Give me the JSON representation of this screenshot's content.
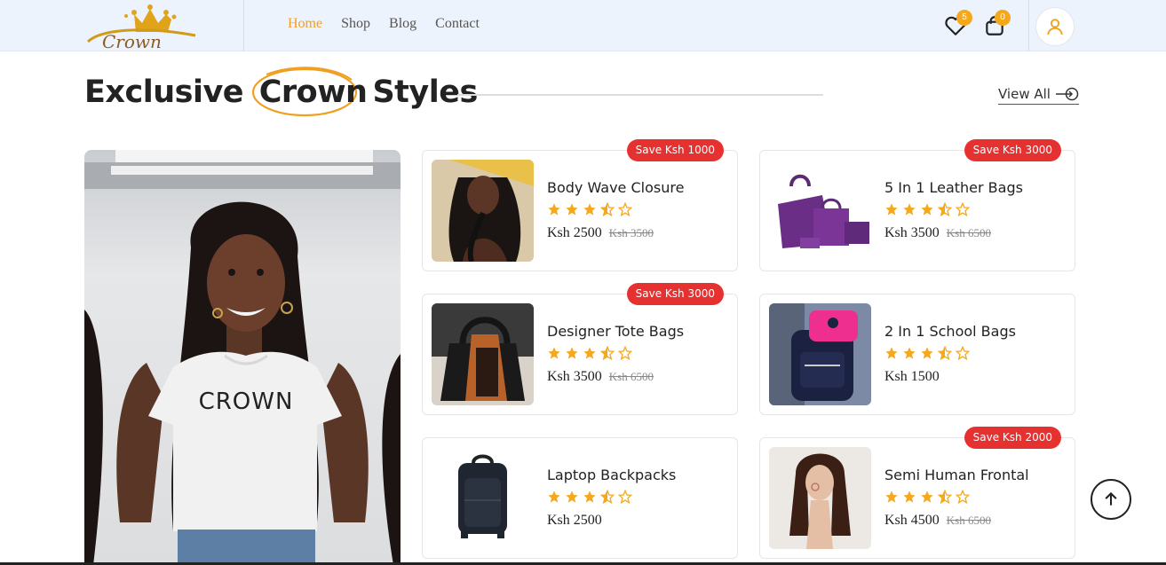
{
  "header": {
    "logo_text": "Crown",
    "nav": [
      {
        "label": "Home",
        "active": true
      },
      {
        "label": "Shop",
        "active": false
      },
      {
        "label": "Blog",
        "active": false
      },
      {
        "label": "Contact",
        "active": false
      }
    ],
    "wishlist_count": "5",
    "cart_count": "0",
    "icons": [
      "heart-icon",
      "shopping-bag-icon",
      "user-icon"
    ]
  },
  "section": {
    "title_before": "Exclusive",
    "title_accent": "Crown",
    "title_after": "Styles",
    "view_all": "View All"
  },
  "hero": {
    "shirt_text": "CROWN"
  },
  "products": [
    {
      "name": "Body Wave Closure",
      "rating": 3.5,
      "price": "Ksh 2500",
      "old_price": "Ksh 3500",
      "save": "Save Ksh 1000"
    },
    {
      "name": "5 In 1 Leather Bags",
      "rating": 3.5,
      "price": "Ksh 3500",
      "old_price": "Ksh 6500",
      "save": "Save Ksh 3000"
    },
    {
      "name": "Designer Tote Bags",
      "rating": 3.5,
      "price": "Ksh 3500",
      "old_price": "Ksh 6500",
      "save": "Save Ksh 3000"
    },
    {
      "name": "2 In 1 School Bags",
      "rating": 3.5,
      "price": "Ksh 1500",
      "old_price": "",
      "save": ""
    },
    {
      "name": "Laptop Backpacks",
      "rating": 3.5,
      "price": "Ksh 2500",
      "old_price": "",
      "save": ""
    },
    {
      "name": "Semi Human Frontal",
      "rating": 3.5,
      "price": "Ksh 4500",
      "old_price": "Ksh 6500",
      "save": "Save Ksh 2000"
    }
  ],
  "colors": {
    "accent": "#f0a020",
    "save_badge": "#e5312f",
    "header_bg": "#edf3fc",
    "star": "#f5a81c"
  }
}
